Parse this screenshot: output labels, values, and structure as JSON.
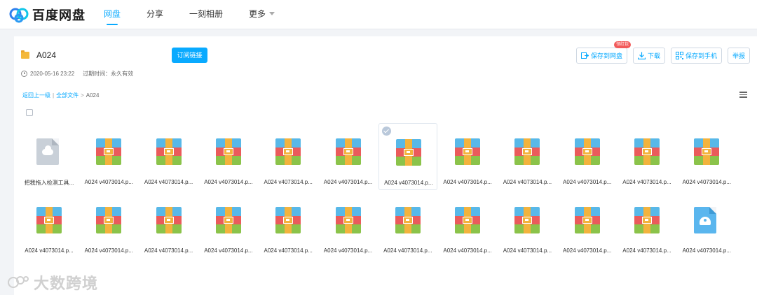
{
  "app": {
    "name": "百度网盘"
  },
  "nav": {
    "items": [
      {
        "label": "网盘",
        "active": true
      },
      {
        "label": "分享",
        "active": false
      },
      {
        "label": "一刻相册",
        "active": false
      },
      {
        "label": "更多",
        "active": false
      }
    ]
  },
  "share": {
    "folder_name": "A024",
    "subscribe_label": "订阅链接",
    "date": "2020-05-16 23:22",
    "expiry": "过期时间：永久有效"
  },
  "actions": {
    "save_to_disk": "保存到网盘",
    "save_badge": "领红包",
    "download": "下载",
    "save_to_phone": "保存到手机",
    "report": "举报"
  },
  "breadcrumb": {
    "back": "返回上一级",
    "divider": "|",
    "all_files": "全部文件",
    "sep": ">",
    "current": "A024"
  },
  "files": [
    {
      "name": "把我拖入检测工具...",
      "type": "cloud-doc"
    },
    {
      "name": "A024 v4073014.p...",
      "type": "zip"
    },
    {
      "name": "A024 v4073014.p...",
      "type": "zip"
    },
    {
      "name": "A024 v4073014.p...",
      "type": "zip"
    },
    {
      "name": "A024 v4073014.p...",
      "type": "zip"
    },
    {
      "name": "A024 v4073014.p...",
      "type": "zip"
    },
    {
      "name": "A024 v4073014.p...",
      "type": "zip",
      "selected": true
    },
    {
      "name": "A024 v4073014.p...",
      "type": "zip"
    },
    {
      "name": "A024 v4073014.p...",
      "type": "zip"
    },
    {
      "name": "A024 v4073014.p...",
      "type": "zip"
    },
    {
      "name": "A024 v4073014.p...",
      "type": "zip"
    },
    {
      "name": "A024 v4073014.p...",
      "type": "zip"
    },
    {
      "name": "A024 v4073014.p...",
      "type": "zip"
    },
    {
      "name": "A024 v4073014.p...",
      "type": "zip"
    },
    {
      "name": "A024 v4073014.p...",
      "type": "zip"
    },
    {
      "name": "A024 v4073014.p...",
      "type": "zip"
    },
    {
      "name": "A024 v4073014.p...",
      "type": "zip"
    },
    {
      "name": "A024 v4073014.p...",
      "type": "zip"
    },
    {
      "name": "A024 v4073014.p...",
      "type": "zip"
    },
    {
      "name": "A024 v4073014.p...",
      "type": "zip"
    },
    {
      "name": "A024 v4073014.p...",
      "type": "zip"
    },
    {
      "name": "A024 v4073014.p...",
      "type": "zip"
    },
    {
      "name": "A024 v4073014.p...",
      "type": "zip"
    },
    {
      "name": "A024 v4073014.p...",
      "type": "blue-doc"
    }
  ],
  "watermark": {
    "text": "大数跨境"
  },
  "colors": {
    "accent": "#09aaff",
    "badge": "#f25a5a"
  }
}
